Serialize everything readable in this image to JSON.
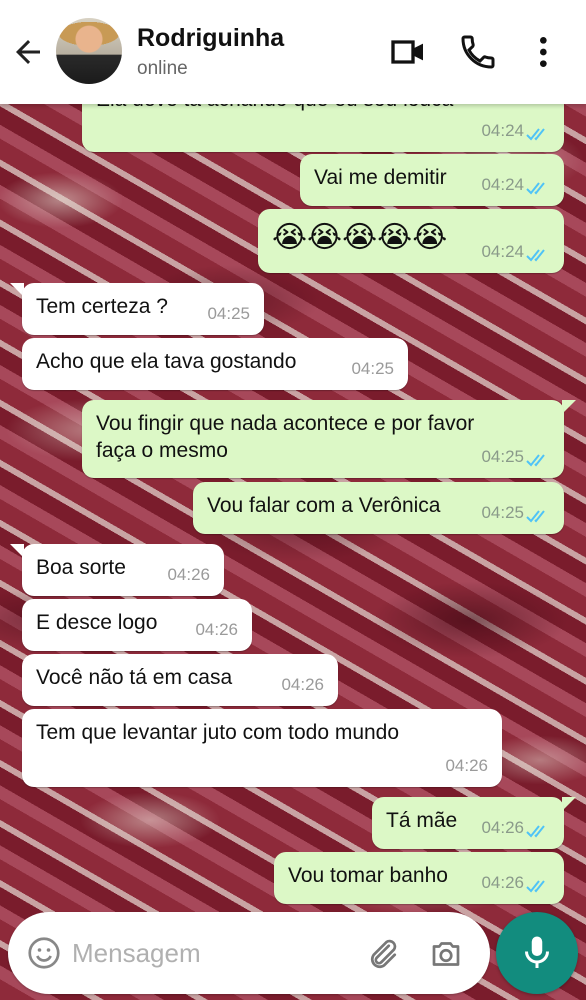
{
  "header": {
    "contact_name": "Rodriguinha",
    "status": "online",
    "icons": [
      "back-arrow-icon",
      "video-call-icon",
      "phone-icon",
      "more-options-icon"
    ]
  },
  "messages": [
    {
      "dir": "out",
      "text": "Ela deve tá achando que eu sou louca",
      "time": "04:24",
      "read": true
    },
    {
      "dir": "out",
      "text": "Vai me demitir",
      "time": "04:24",
      "read": true
    },
    {
      "dir": "out",
      "text": "😭😭😭😭😭",
      "time": "04:24",
      "read": true
    },
    {
      "dir": "in",
      "text": "Tem certeza ?",
      "time": "04:25"
    },
    {
      "dir": "in",
      "text": "Acho que ela tava gostando",
      "time": "04:25"
    },
    {
      "dir": "out",
      "text": "Vou fingir que nada acontece e por favor\nfaça o mesmo",
      "time": "04:25",
      "read": true
    },
    {
      "dir": "out",
      "text": "Vou falar com a Verônica",
      "time": "04:25",
      "read": true
    },
    {
      "dir": "in",
      "text": "Boa sorte",
      "time": "04:26"
    },
    {
      "dir": "in",
      "text": "E desce logo",
      "time": "04:26"
    },
    {
      "dir": "in",
      "text": "Você não tá em casa",
      "time": "04:26"
    },
    {
      "dir": "in",
      "text": "Tem que levantar juto com todo mundo",
      "time": "04:26"
    },
    {
      "dir": "out",
      "text": "Tá mãe",
      "time": "04:26",
      "read": true
    },
    {
      "dir": "out",
      "text": "Vou tomar banho",
      "time": "04:26",
      "read": true
    }
  ],
  "composer": {
    "placeholder": "Mensagem",
    "value": ""
  },
  "colors": {
    "outgoing_bubble": "#dcf8c6",
    "incoming_bubble": "#ffffff",
    "read_ticks": "#4fc3f7",
    "mic_button": "#128c7e"
  }
}
